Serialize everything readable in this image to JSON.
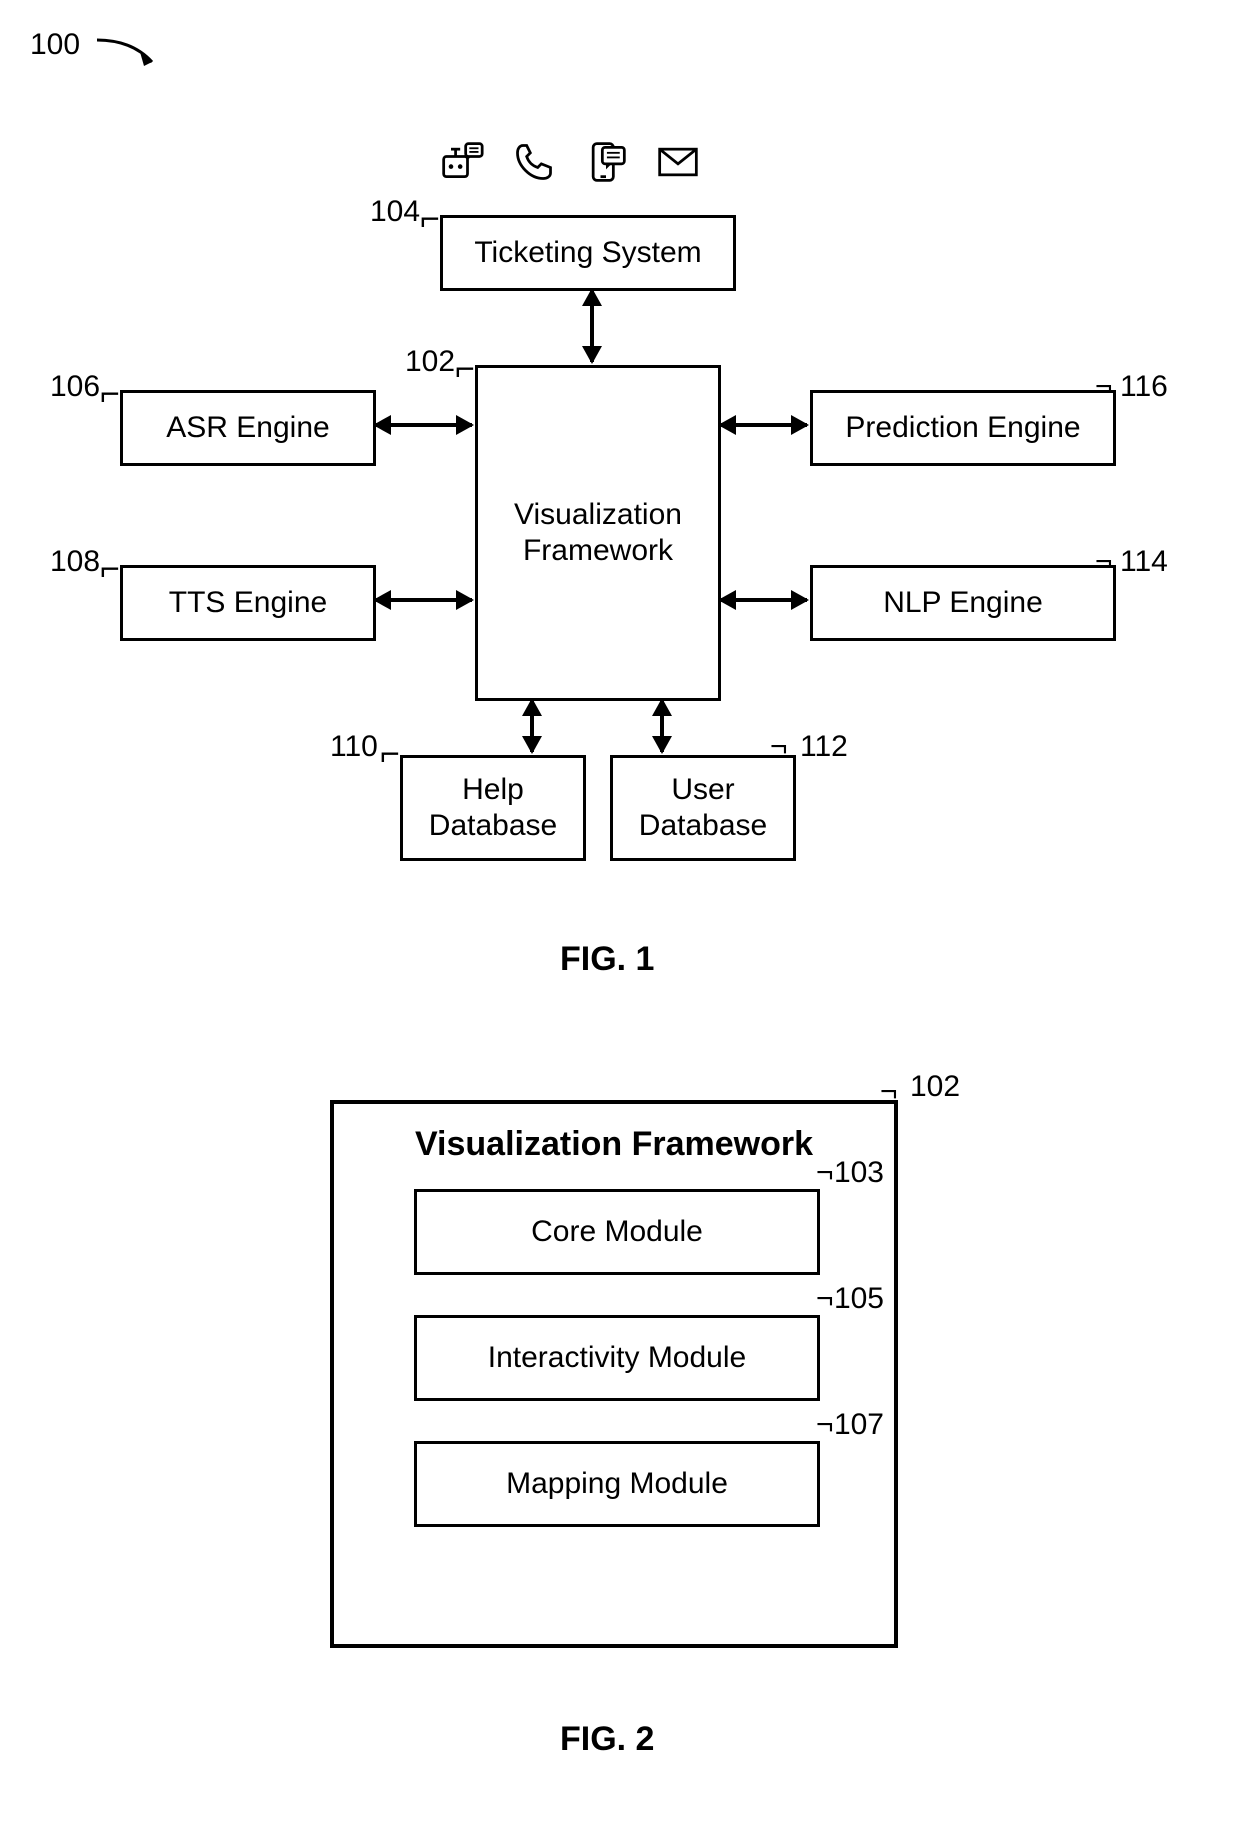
{
  "fig1": {
    "systemLabel": "100",
    "centerBox": {
      "ref": "102",
      "line1": "Visualization",
      "line2": "Framework"
    },
    "ticketing": {
      "ref": "104",
      "label": "Ticketing System"
    },
    "asr": {
      "ref": "106",
      "label": "ASR Engine"
    },
    "tts": {
      "ref": "108",
      "label": "TTS Engine"
    },
    "helpdb": {
      "ref": "110",
      "line1": "Help",
      "line2": "Database"
    },
    "userdb": {
      "ref": "112",
      "line1": "User",
      "line2": "Database"
    },
    "nlp": {
      "ref": "114",
      "label": "NLP Engine"
    },
    "prediction": {
      "ref": "116",
      "label": "Prediction Engine"
    },
    "caption": "FIG. 1"
  },
  "fig2": {
    "ref": "102",
    "title": "Visualization Framework",
    "core": {
      "ref": "103",
      "label": "Core Module"
    },
    "interactivity": {
      "ref": "105",
      "label": "Interactivity Module"
    },
    "mapping": {
      "ref": "107",
      "label": "Mapping Module"
    },
    "caption": "FIG. 2"
  }
}
